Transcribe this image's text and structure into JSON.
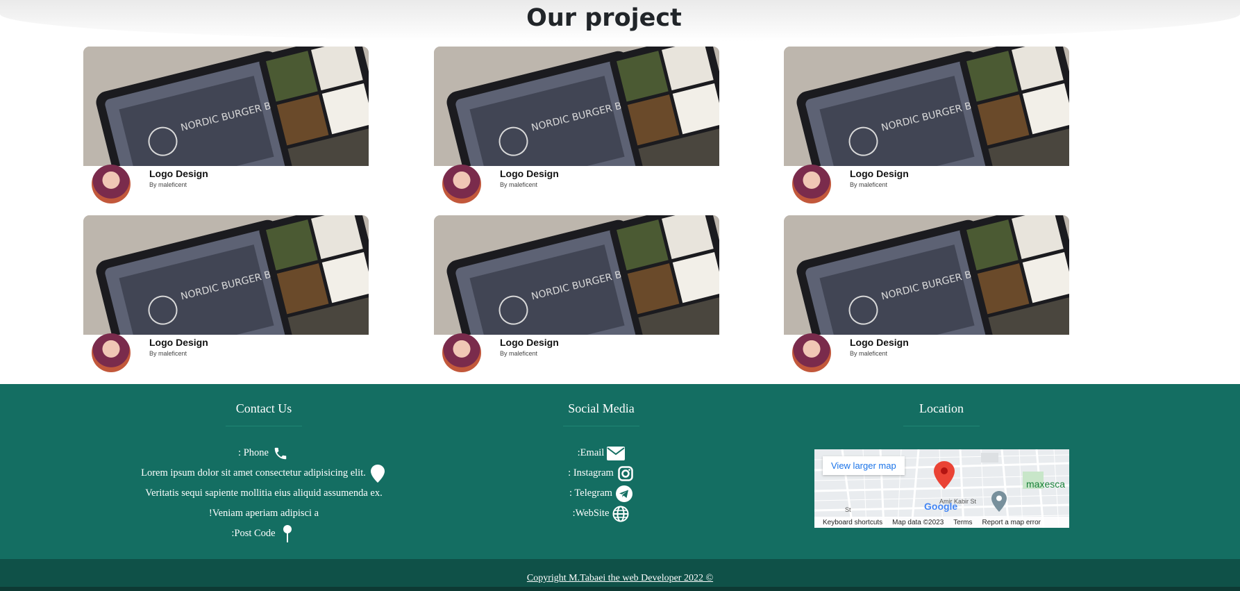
{
  "projects": {
    "title": "Our project",
    "cards": [
      {
        "title": "Logo Design",
        "author": "By maleficent"
      },
      {
        "title": "Logo Design",
        "author": "By maleficent"
      },
      {
        "title": "Logo Design",
        "author": "By maleficent"
      },
      {
        "title": "Logo Design",
        "author": "By maleficent"
      },
      {
        "title": "Logo Design",
        "author": "By maleficent"
      },
      {
        "title": "Logo Design",
        "author": "By maleficent"
      }
    ],
    "thumb_text": "NORDIC BURGER BAR"
  },
  "footer": {
    "contact": {
      "heading": "Contact Us",
      "phone": ": Phone",
      "address_1": "Lorem ipsum dolor sit amet consectetur adipisicing elit.",
      "address_2": "Veritatis sequi sapiente mollitia eius aliquid assumenda ex.",
      "address_3": "!Veniam aperiam adipisci a",
      "post_code": ":Post Code"
    },
    "social": {
      "heading": "Social Media",
      "email": ":Email",
      "instagram": ": Instagram",
      "telegram": ": Telegram",
      "website": ":WebSite"
    },
    "location": {
      "heading": "Location",
      "map_button": "View larger map",
      "map_footer": [
        "Keyboard shortcuts",
        "Map data ©2023",
        "Terms",
        "Report a map error"
      ],
      "map_labels": [
        "Amir Kabir St",
        "maxesca",
        "Google",
        "St"
      ]
    },
    "copyright": "Copyright M.Tabaei the web Developer 2022 ©"
  },
  "colors": {
    "footer_bg": "#146e62",
    "copyright_bg": "#0f5148",
    "map_pin": "#ea4335"
  },
  "icons": {
    "phone": "phone-icon",
    "location": "map-marker-icon",
    "post_code": "pin-icon",
    "email": "envelope-icon",
    "instagram": "instagram-icon",
    "telegram": "telegram-icon",
    "website": "globe-icon"
  }
}
